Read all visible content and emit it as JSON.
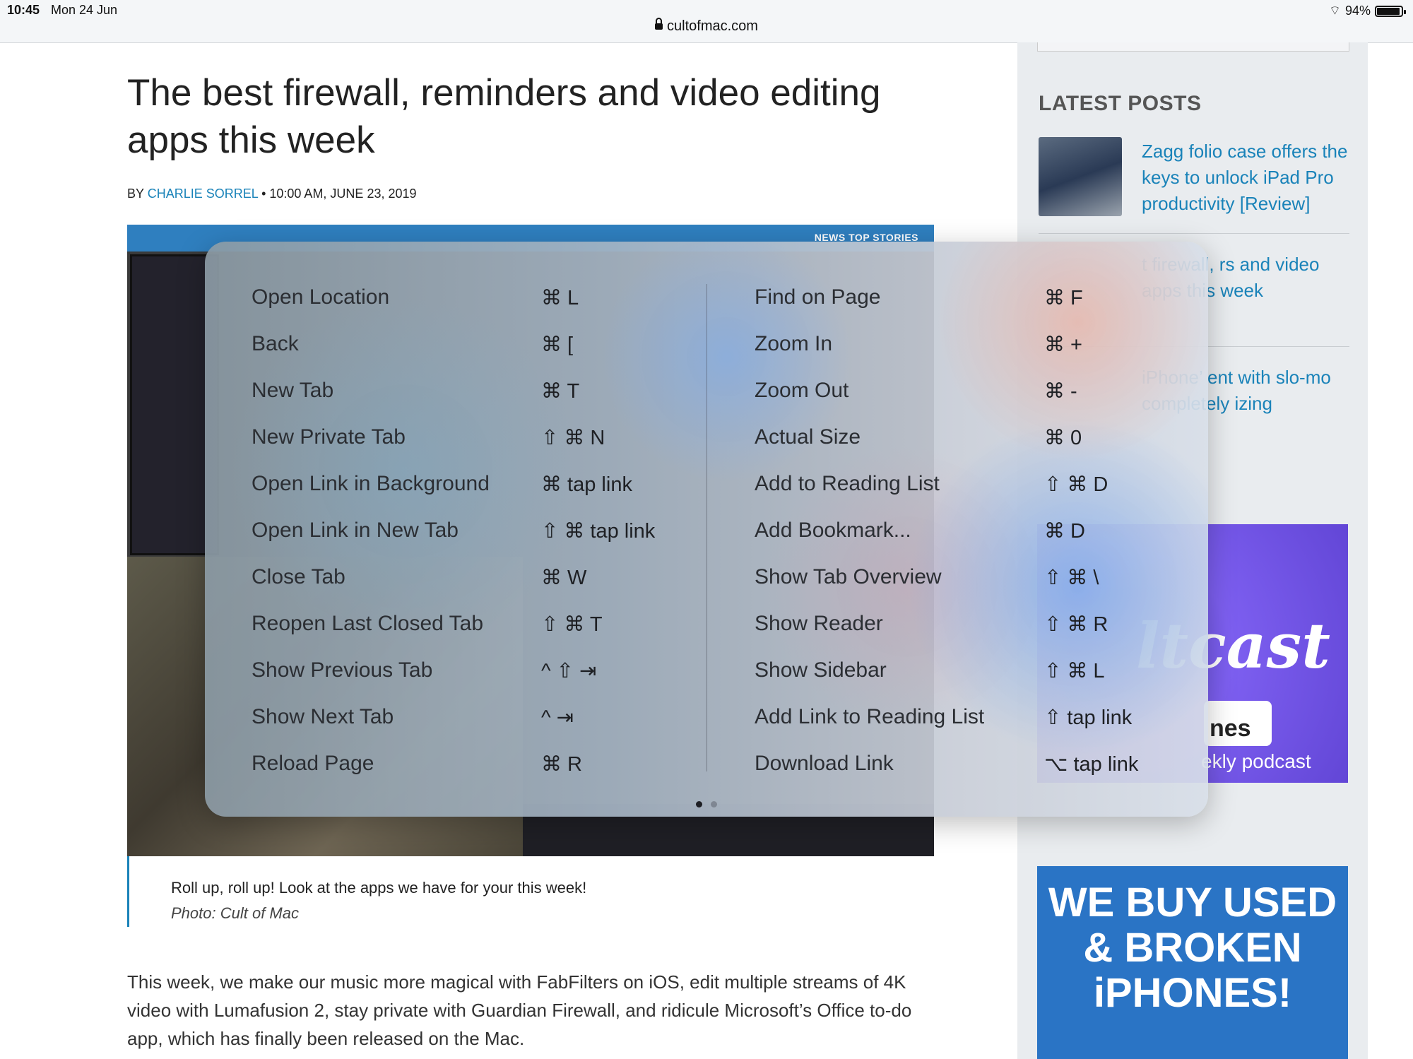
{
  "status_bar": {
    "time": "10:45",
    "date": "Mon 24 Jun",
    "battery": "94%",
    "battery_level": 0.94,
    "url": "cultofmac.com"
  },
  "article": {
    "title": "The best firewall, reminders and video editing apps this week",
    "byline_prefix": "BY",
    "author": "CHARLIE SORREL",
    "byline_suffix": " • 10:00 AM, JUNE 23, 2019",
    "hero_tags": "NEWS   TOP STORIES",
    "caption": "Roll up, roll up! Look at the apps we have for your this week!",
    "credit": "Photo: Cult of Mac",
    "body": "This week, we make our music more magical with FabFilters on iOS, edit multiple streams of 4K video with Lumafusion 2, stay private with Guardian Firewall, and ridicule Microsoft’s Office to-do app, which has finally been released on the Mac."
  },
  "sidebar": {
    "heading": "LATEST POSTS",
    "posts": [
      {
        "title": "Zagg folio case offers the keys to unlock iPad Pro productivity [Review]"
      },
      {
        "title": "t firewall, rs and video apps this week"
      },
      {
        "title": "iPhone’ ent with slo-mo completely izing"
      }
    ],
    "podcast_title": "ltcast",
    "podcast_badge": "nes",
    "podcast_sub": "ekly podcast",
    "buy_ad": "WE BUY USED & BROKEN iPHONES!"
  },
  "shortcuts": {
    "left": [
      {
        "label": "Open Location",
        "keys": "⌘ L"
      },
      {
        "label": "Back",
        "keys": "⌘ ["
      },
      {
        "label": "New Tab",
        "keys": "⌘ T"
      },
      {
        "label": "New Private Tab",
        "keys": "⇧ ⌘ N"
      },
      {
        "label": "Open Link in Background",
        "keys": "⌘ tap link"
      },
      {
        "label": "Open Link in New Tab",
        "keys": "⇧ ⌘ tap link"
      },
      {
        "label": "Close Tab",
        "keys": "⌘ W"
      },
      {
        "label": "Reopen Last Closed Tab",
        "keys": "⇧ ⌘ T"
      },
      {
        "label": "Show Previous Tab",
        "keys": "^ ⇧ ⇥"
      },
      {
        "label": "Show Next Tab",
        "keys": "^ ⇥"
      },
      {
        "label": "Reload Page",
        "keys": "⌘ R"
      }
    ],
    "right": [
      {
        "label": "Find on Page",
        "keys": "⌘ F"
      },
      {
        "label": "Zoom In",
        "keys": "⌘ +"
      },
      {
        "label": "Zoom Out",
        "keys": "⌘ -"
      },
      {
        "label": "Actual Size",
        "keys": "⌘ 0"
      },
      {
        "label": "Add to Reading List",
        "keys": "⇧ ⌘ D"
      },
      {
        "label": "Add Bookmark...",
        "keys": "⌘ D"
      },
      {
        "label": "Show Tab Overview",
        "keys": "⇧ ⌘ \\"
      },
      {
        "label": "Show Reader",
        "keys": "⇧ ⌘ R"
      },
      {
        "label": "Show Sidebar",
        "keys": "⇧ ⌘ L"
      },
      {
        "label": "Add Link to Reading List",
        "keys": "⇧ tap link"
      },
      {
        "label": "Download Link",
        "keys": "⌥ tap link"
      }
    ],
    "page_count": 2,
    "current_page": 1
  }
}
